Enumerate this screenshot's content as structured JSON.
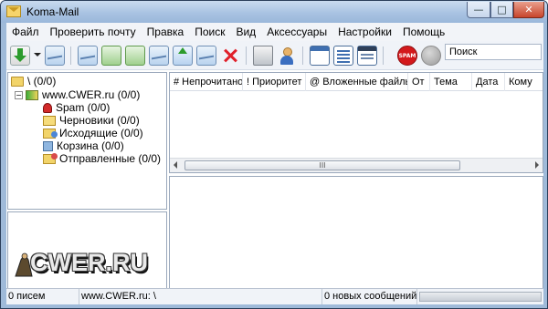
{
  "window": {
    "title": "Koma-Mail",
    "controls": {
      "minimize": "—",
      "maximize": "□",
      "close": "✕"
    }
  },
  "menu": [
    "Файл",
    "Проверить почту",
    "Правка",
    "Поиск",
    "Вид",
    "Аксессуары",
    "Настройки",
    "Помощь"
  ],
  "toolbar": {
    "icons": [
      "get-mail-icon",
      "send-receive-icon",
      "new-message-icon",
      "reply-icon",
      "reply-all-icon",
      "forward-icon",
      "upload-icon",
      "mark-icon",
      "delete-icon",
      "print-icon",
      "address-book-icon",
      "window-icon",
      "list-icon",
      "panel-icon",
      "spam-icon",
      "status-icon"
    ],
    "spam_label": "SPAM",
    "search_placeholder": "Поиск"
  },
  "folders": {
    "root": "\\ (0/0)",
    "account": "www.CWER.ru (0/0)",
    "items": [
      "Spam (0/0)",
      "Черновики (0/0)",
      "Исходящие (0/0)",
      "Корзина (0/0)",
      "Отправленные (0/0)"
    ]
  },
  "message_list": {
    "columns": [
      "# Непрочитано",
      "! Приоритет",
      "@ Вложенные файлы",
      "От",
      "Тема",
      "Дата",
      "Кому"
    ],
    "scroll_thumb": "III"
  },
  "logo": {
    "text": "CWER.RU"
  },
  "status": {
    "count": "0 писем",
    "path": "www.CWER.ru: \\",
    "new": "0 новых сообщений"
  }
}
